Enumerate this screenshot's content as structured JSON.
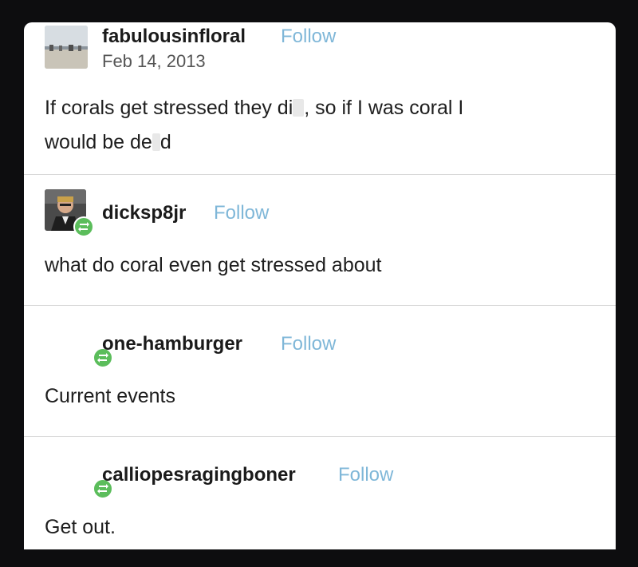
{
  "posts": [
    {
      "username": "fabulousinfloral",
      "follow_label": "Follow",
      "date": "Feb 14, 2013",
      "text_part1": "If corals get stressed they di",
      "text_part2": ", so if I was coral I",
      "text_line2_part1": "would be de",
      "text_line2_part2": "d"
    },
    {
      "username": "dicksp8jr",
      "follow_label": "Follow",
      "text": "what do coral even get stressed about"
    },
    {
      "username": "one-hamburger",
      "follow_label": "Follow",
      "text": "Current events"
    },
    {
      "username": "calliopesragingboner",
      "follow_label": "Follow",
      "text": "Get out."
    }
  ],
  "colors": {
    "follow": "#7fb7d8",
    "reblog_badge": "#5bbd5b",
    "background": "#0d0d0f",
    "card": "#ffffff"
  },
  "icons": {
    "reblog": "reblog-icon"
  }
}
